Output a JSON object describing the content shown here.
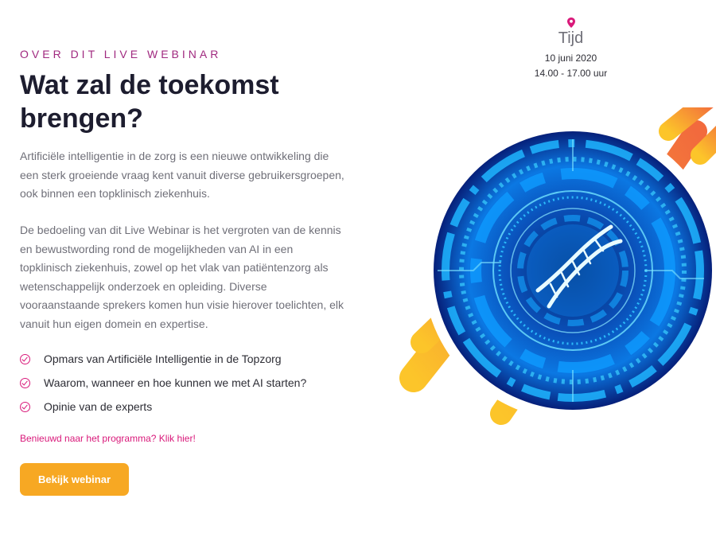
{
  "section": {
    "eyebrow": "OVER DIT LIVE WEBINAR",
    "title": "Wat zal de toekomst brengen?",
    "paragraphs": [
      "Artificiële intelligentie in de zorg is een nieuwe ontwikkeling die een sterk groeiende vraag kent vanuit diverse gebruikersgroepen, ook binnen een topklinisch ziekenhuis.",
      "De bedoeling van dit Live Webinar is het vergroten van de kennis en bewustwording rond de mogelijkheden van AI in een topklinisch ziekenhuis, zowel op het vlak van patiëntenzorg als wetenschappelijk onderzoek en opleiding. Diverse vooraanstaande sprekers komen hun visie hierover toelichten, elk vanuit hun eigen domein en expertise."
    ],
    "bullets": [
      "Opmars van Artificiële Intelligentie in de Topzorg",
      "Waarom, wanneer en hoe kunnen we met AI starten?",
      "Opinie van de experts"
    ],
    "program_link": "Benieuwd naar het programma? Klik hier!",
    "cta_label": "Bekijk webinar"
  },
  "event": {
    "icon": "location-pin-icon",
    "label": "Tijd",
    "date": "10 juni 2020",
    "time": "14.00 - 17.00 uur"
  },
  "colors": {
    "accent_pink": "#d9197a",
    "eyebrow_purple": "#a0297f",
    "button_orange": "#f7a823"
  }
}
